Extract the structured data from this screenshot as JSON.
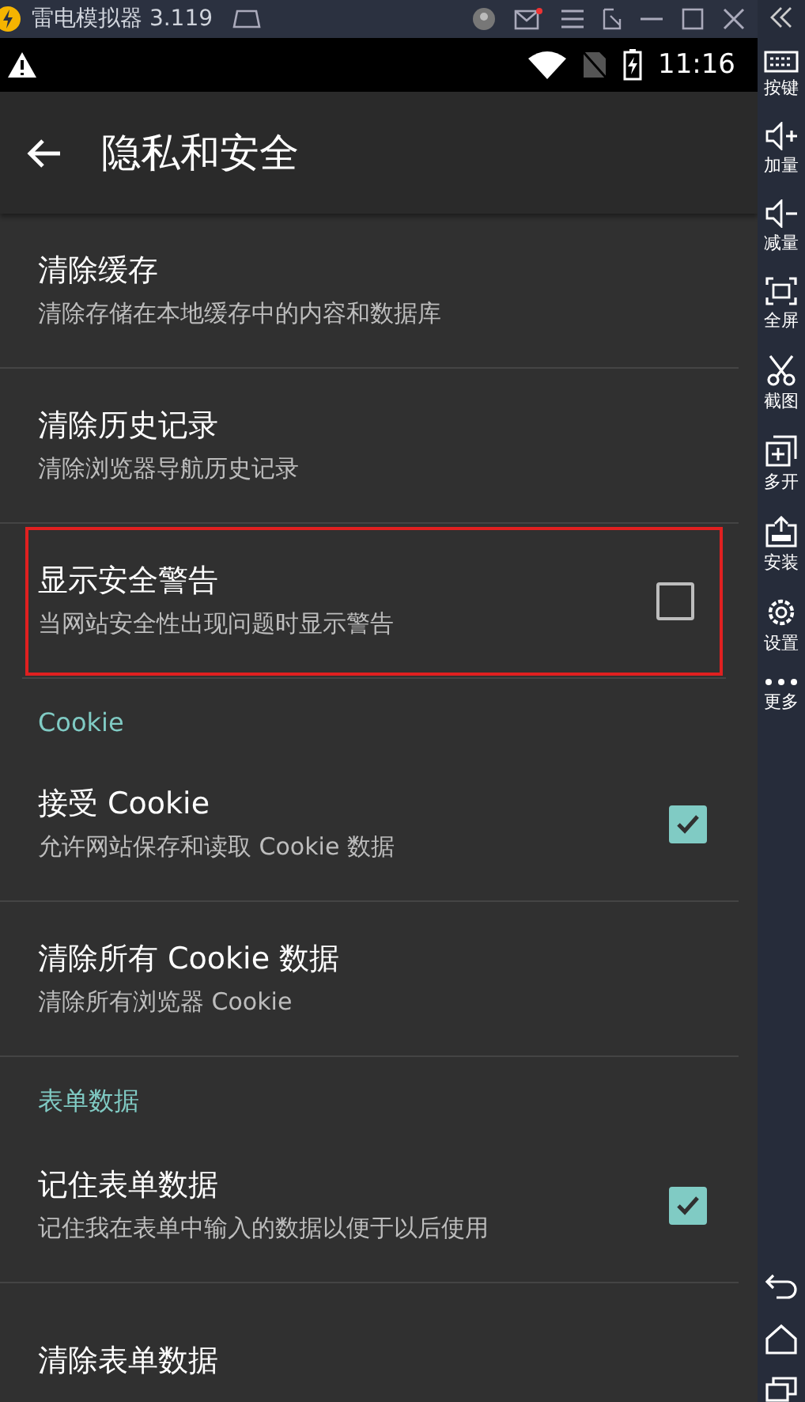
{
  "emulator_bar": {
    "title": "雷电模拟器 3.119"
  },
  "status_bar": {
    "time": "11:16"
  },
  "app_bar": {
    "title": "隐私和安全"
  },
  "items": [
    {
      "kind": "pref",
      "title": "清除缓存",
      "summary": "清除存储在本地缓存中的内容和数据库",
      "highlighted": false
    },
    {
      "kind": "pref",
      "title": "清除历史记录",
      "summary": "清除浏览器导航历史记录",
      "highlighted": false
    },
    {
      "kind": "check",
      "title": "显示安全警告",
      "summary": "当网站安全性出现问题时显示警告",
      "checked": false,
      "highlighted": true
    },
    {
      "kind": "header",
      "title": "Cookie"
    },
    {
      "kind": "check",
      "title": "接受 Cookie",
      "summary": "允许网站保存和读取 Cookie 数据",
      "checked": true,
      "highlighted": false
    },
    {
      "kind": "pref",
      "title": "清除所有 Cookie 数据",
      "summary": "清除所有浏览器 Cookie",
      "highlighted": false
    },
    {
      "kind": "header",
      "title": "表单数据"
    },
    {
      "kind": "check",
      "title": "记住表单数据",
      "summary": "记住我在表单中输入的数据以便于以后使用",
      "checked": true,
      "highlighted": false
    },
    {
      "kind": "pref",
      "title": "清除表单数据",
      "highlighted": false
    }
  ],
  "side_tools": [
    {
      "label": "按键",
      "kind": "keyboard"
    },
    {
      "label": "加量",
      "kind": "volup"
    },
    {
      "label": "减量",
      "kind": "voldown"
    },
    {
      "label": "全屏",
      "kind": "full"
    },
    {
      "label": "截图",
      "kind": "scissors"
    },
    {
      "label": "多开",
      "kind": "multi"
    },
    {
      "label": "安装",
      "kind": "apk"
    },
    {
      "label": "设置",
      "kind": "gear"
    },
    {
      "label": "更多",
      "kind": "more"
    }
  ]
}
